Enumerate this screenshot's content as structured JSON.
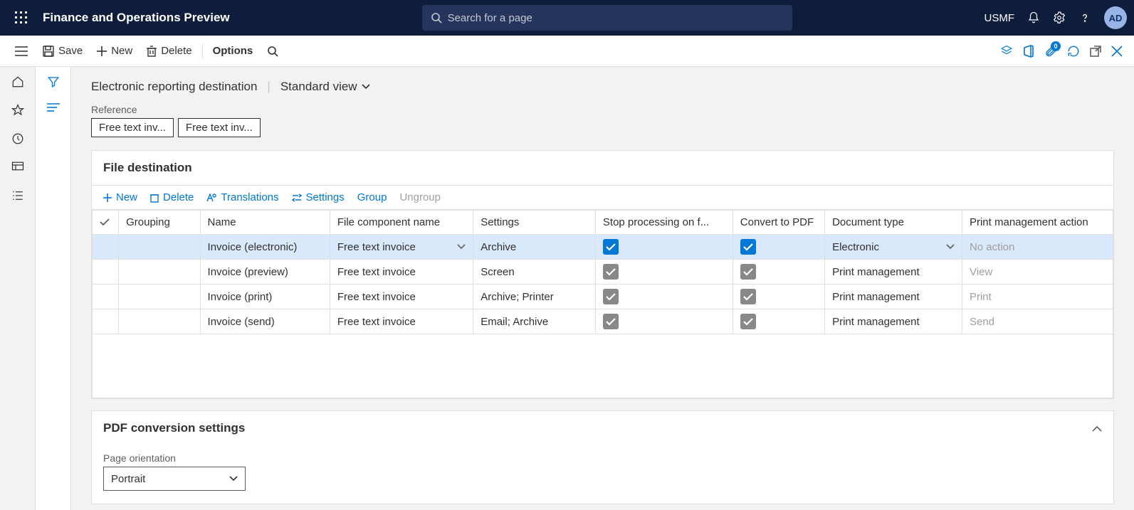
{
  "topbar": {
    "app_title": "Finance and Operations Preview",
    "search_placeholder": "Search for a page",
    "company": "USMF",
    "avatar": "AD"
  },
  "actionbar": {
    "save": "Save",
    "new": "New",
    "delete": "Delete",
    "options": "Options",
    "attach_badge": "0"
  },
  "breadcrumb": {
    "page": "Electronic reporting destination",
    "view": "Standard view"
  },
  "reference": {
    "label": "Reference",
    "pills": [
      "Free text inv...",
      "Free text inv..."
    ]
  },
  "file_dest": {
    "title": "File destination",
    "toolbar": {
      "new": "New",
      "delete": "Delete",
      "translations": "Translations",
      "settings": "Settings",
      "group": "Group",
      "ungroup": "Ungroup"
    },
    "columns": {
      "grouping": "Grouping",
      "name": "Name",
      "file": "File component name",
      "settings": "Settings",
      "stop": "Stop processing on f...",
      "pdf": "Convert to PDF",
      "doctype": "Document type",
      "pma": "Print management action"
    },
    "rows": [
      {
        "name": "Invoice (electronic)",
        "file": "Free text invoice",
        "settings": "Archive",
        "stop": true,
        "pdf": true,
        "doctype": "Electronic",
        "pma": "No action",
        "selected": true,
        "stop_variant": "blue",
        "pdf_variant": "blue",
        "pma_muted": true,
        "doctype_dd": true,
        "file_dd": true
      },
      {
        "name": "Invoice (preview)",
        "file": "Free text invoice",
        "settings": "Screen",
        "stop": true,
        "pdf": true,
        "doctype": "Print management",
        "pma": "View",
        "stop_variant": "gray",
        "pdf_variant": "gray",
        "pma_muted": true
      },
      {
        "name": "Invoice (print)",
        "file": "Free text invoice",
        "settings": "Archive; Printer",
        "stop": true,
        "pdf": true,
        "doctype": "Print management",
        "pma": "Print",
        "stop_variant": "gray",
        "pdf_variant": "gray",
        "pma_muted": true
      },
      {
        "name": "Invoice (send)",
        "file": "Free text invoice",
        "settings": "Email; Archive",
        "stop": true,
        "pdf": true,
        "doctype": "Print management",
        "pma": "Send",
        "stop_variant": "gray",
        "pdf_variant": "gray",
        "pma_muted": true
      }
    ]
  },
  "pdf": {
    "title": "PDF conversion settings",
    "orientation_label": "Page orientation",
    "orientation_value": "Portrait"
  }
}
